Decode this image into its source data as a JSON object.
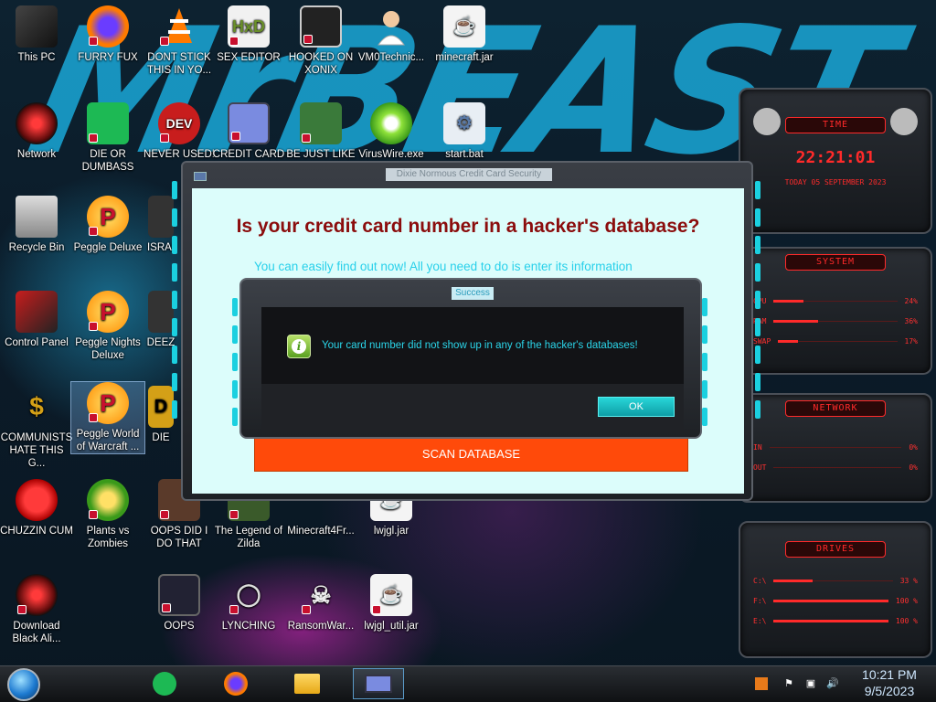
{
  "desktop": {
    "wallpaper_text": "MrBEAST",
    "icons": [
      {
        "label": "This PC"
      },
      {
        "label": "FURRY FUX"
      },
      {
        "label": "DONT STICK THIS IN YO..."
      },
      {
        "label": "SEX EDITOR"
      },
      {
        "label": "HOOKED ON XONIX"
      },
      {
        "label": "VM0Technic..."
      },
      {
        "label": "minecraft.jar"
      },
      {
        "label": "Network"
      },
      {
        "label": "DIE OR DUMBASS"
      },
      {
        "label": "NEVER USED!"
      },
      {
        "label": "CREDIT CARD"
      },
      {
        "label": "BE JUST LIKE"
      },
      {
        "label": "VirusWire.exe"
      },
      {
        "label": "start.bat"
      },
      {
        "label": "Recycle Bin"
      },
      {
        "label": "Peggle Deluxe"
      },
      {
        "label": "ISRAI"
      },
      {
        "label": "Control Panel"
      },
      {
        "label": "Peggle Nights Deluxe"
      },
      {
        "label": "DEEZ"
      },
      {
        "label": "COMMUNISTS HATE THIS G..."
      },
      {
        "label": "Peggle World of Warcraft ..."
      },
      {
        "label": "DIE"
      },
      {
        "label": "CHUZZIN CUM"
      },
      {
        "label": "Plants vs Zombies"
      },
      {
        "label": "OOPS DID I DO THAT"
      },
      {
        "label": "The Legend of Zilda"
      },
      {
        "label": "Minecraft4Fr..."
      },
      {
        "label": "lwjgl.jar"
      },
      {
        "label": "Download Black Ali..."
      },
      {
        "label": "OOPS"
      },
      {
        "label": "LYNCHING"
      },
      {
        "label": "RansomWar..."
      },
      {
        "label": "lwjgl_util.jar"
      }
    ]
  },
  "main_window": {
    "title": "Dixie Normous Credit Card Security",
    "heading": "Is your credit card number in a hacker's database?",
    "subtext": "You can easily find out now! All you need to do is enter its information",
    "scan_button": "SCAN DATABASE"
  },
  "dialog": {
    "title": "Success",
    "message": "Your card number did not show up in any of the hacker's databases!",
    "ok_label": "OK"
  },
  "widgets": {
    "time": {
      "title": "TIME",
      "clock": "22:21:01",
      "date": "TODAY 05 SEPTEMBER 2023"
    },
    "system": {
      "title": "SYSTEM",
      "rows": [
        {
          "label": "CPU",
          "value": "24%"
        },
        {
          "label": "RAM",
          "value": "36%"
        },
        {
          "label": "SWAP",
          "value": "17%"
        }
      ]
    },
    "network": {
      "title": "NETWORK",
      "rows": [
        {
          "label": "IN",
          "value": "0%"
        },
        {
          "label": "OUT",
          "value": "0%"
        }
      ]
    },
    "drives": {
      "title": "DRIVES",
      "rows": [
        {
          "label": "C:\\",
          "value": "33 %"
        },
        {
          "label": "F:\\",
          "value": "100 %"
        },
        {
          "label": "E:\\",
          "value": "100 %"
        }
      ]
    }
  },
  "taskbar": {
    "time": "10:21 PM",
    "date": "9/5/2023",
    "apps": [
      "spotify-icon",
      "firefox-icon",
      "file-explorer-icon",
      "credit-card-app-icon"
    ]
  },
  "colors": {
    "accent": "#1bd0e0",
    "scan_button": "#ff4a0a",
    "heading": "#8b0d0d",
    "widget_red": "#ff2a2a"
  }
}
